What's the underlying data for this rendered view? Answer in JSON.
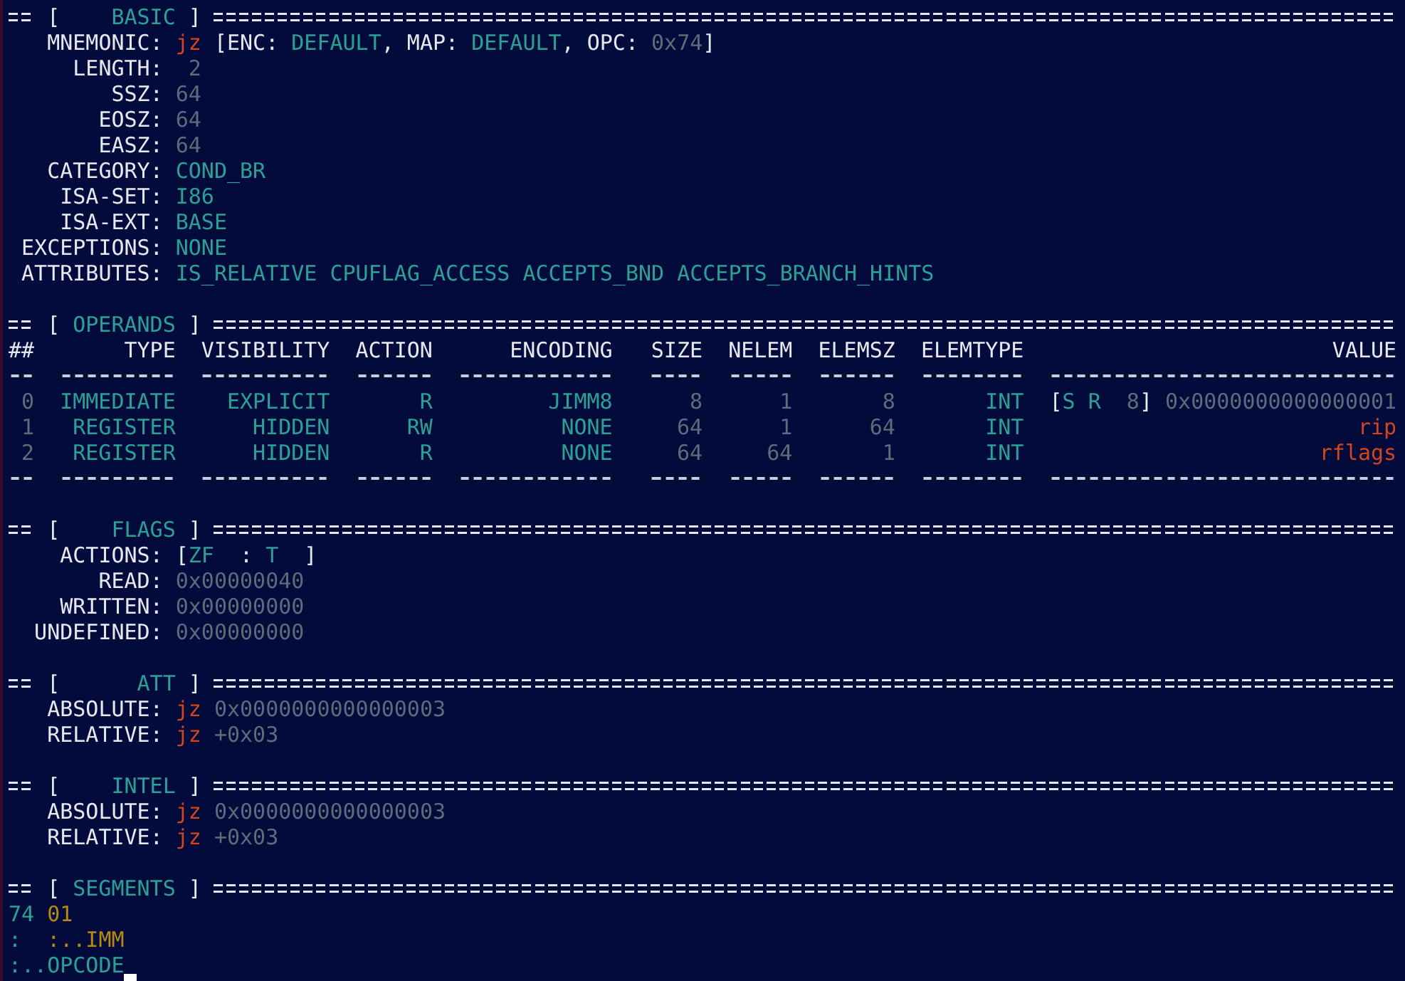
{
  "sections": [
    {
      "kind": "fields",
      "header": [
        {
          "text": "[",
          "kind": "plain"
        },
        {
          "text": "    BASIC",
          "kind": "keyword"
        },
        {
          "text": " ]",
          "kind": "plain"
        }
      ],
      "fields": [
        {
          "label": "MNEMONIC:",
          "value": [
            {
              "text": "jz",
              "kind": "mnemonic"
            },
            {
              "text": " [ENC: ",
              "kind": "plain"
            },
            {
              "text": "DEFAULT",
              "kind": "keyword"
            },
            {
              "text": ", MAP: ",
              "kind": "plain"
            },
            {
              "text": "DEFAULT",
              "kind": "keyword"
            },
            {
              "text": ", OPC: ",
              "kind": "plain"
            },
            {
              "text": "0x74",
              "kind": "number"
            },
            {
              "text": "]",
              "kind": "plain"
            }
          ]
        },
        {
          "label": "LENGTH:",
          "value": [
            {
              "text": " 2",
              "kind": "number"
            }
          ]
        },
        {
          "label": "SSZ:",
          "value": [
            {
              "text": "64",
              "kind": "number"
            }
          ]
        },
        {
          "label": "EOSZ:",
          "value": [
            {
              "text": "64",
              "kind": "number"
            }
          ]
        },
        {
          "label": "EASZ:",
          "value": [
            {
              "text": "64",
              "kind": "number"
            }
          ]
        },
        {
          "label": "CATEGORY:",
          "value": [
            {
              "text": "COND_BR",
              "kind": "keyword"
            }
          ]
        },
        {
          "label": "ISA-SET:",
          "value": [
            {
              "text": "I86",
              "kind": "keyword"
            }
          ]
        },
        {
          "label": "ISA-EXT:",
          "value": [
            {
              "text": "BASE",
              "kind": "keyword"
            }
          ]
        },
        {
          "label": "EXCEPTIONS:",
          "value": [
            {
              "text": "NONE",
              "kind": "keyword"
            }
          ]
        },
        {
          "label": "ATTRIBUTES:",
          "value": [
            {
              "text": "IS_RELATIVE CPUFLAG_ACCESS ACCEPTS_BND ACCEPTS_BRANCH_HINTS",
              "kind": "keyword"
            }
          ]
        }
      ]
    },
    {
      "kind": "table",
      "header": [
        {
          "text": "[",
          "kind": "plain"
        },
        {
          "text": " OPERANDS",
          "kind": "keyword"
        },
        {
          "text": " ]",
          "kind": "plain"
        }
      ],
      "columns": [
        "##",
        "TYPE",
        "VISIBILITY",
        "ACTION",
        "ENCODING",
        "SIZE",
        "NELEM",
        "ELEMSZ",
        "ELEMTYPE",
        "VALUE"
      ],
      "rows": [
        {
          "cells": [
            "0",
            "IMMEDIATE",
            "EXPLICIT",
            "R",
            "JIMM8",
            "8",
            "1",
            "8",
            "INT"
          ],
          "value": [
            {
              "text": "[",
              "kind": "plain"
            },
            {
              "text": "S R",
              "kind": "keyword"
            },
            {
              "text": "  8",
              "kind": "number"
            },
            {
              "text": "]",
              "kind": "plain"
            },
            {
              "text": " 0x0000000000000001",
              "kind": "number"
            }
          ]
        },
        {
          "cells": [
            "1",
            "REGISTER",
            "HIDDEN",
            "RW",
            "NONE",
            "64",
            "1",
            "64",
            "INT"
          ],
          "value": [
            {
              "text": "rip",
              "kind": "mnemonic"
            }
          ]
        },
        {
          "cells": [
            "2",
            "REGISTER",
            "HIDDEN",
            "R",
            "NONE",
            "64",
            "64",
            "1",
            "INT"
          ],
          "value": [
            {
              "text": "rflags",
              "kind": "mnemonic"
            }
          ]
        }
      ]
    },
    {
      "kind": "fields",
      "header": [
        {
          "text": "[",
          "kind": "plain"
        },
        {
          "text": "    FLAGS",
          "kind": "keyword"
        },
        {
          "text": " ]",
          "kind": "plain"
        }
      ],
      "fields": [
        {
          "label": "ACTIONS:",
          "value": [
            {
              "text": "[",
              "kind": "plain"
            },
            {
              "text": "ZF",
              "kind": "keyword"
            },
            {
              "text": "  : ",
              "kind": "plain"
            },
            {
              "text": "T",
              "kind": "keyword"
            },
            {
              "text": "  ]",
              "kind": "plain"
            }
          ]
        },
        {
          "label": "READ:",
          "value": [
            {
              "text": "0x00000040",
              "kind": "number"
            }
          ]
        },
        {
          "label": "WRITTEN:",
          "value": [
            {
              "text": "0x00000000",
              "kind": "number"
            }
          ]
        },
        {
          "label": "UNDEFINED:",
          "value": [
            {
              "text": "0x00000000",
              "kind": "number"
            }
          ]
        }
      ]
    },
    {
      "kind": "fields",
      "header": [
        {
          "text": "[",
          "kind": "plain"
        },
        {
          "text": "      ATT",
          "kind": "keyword"
        },
        {
          "text": " ]",
          "kind": "plain"
        }
      ],
      "fields": [
        {
          "label": "ABSOLUTE:",
          "value": [
            {
              "text": "jz",
              "kind": "mnemonic"
            },
            {
              "text": " 0x0000000000000003",
              "kind": "number"
            }
          ]
        },
        {
          "label": "RELATIVE:",
          "value": [
            {
              "text": "jz",
              "kind": "mnemonic"
            },
            {
              "text": " +0x03",
              "kind": "number"
            }
          ]
        }
      ]
    },
    {
      "kind": "fields",
      "header": [
        {
          "text": "[",
          "kind": "plain"
        },
        {
          "text": "    INTEL",
          "kind": "keyword"
        },
        {
          "text": " ]",
          "kind": "plain"
        }
      ],
      "fields": [
        {
          "label": "ABSOLUTE:",
          "value": [
            {
              "text": "jz",
              "kind": "mnemonic"
            },
            {
              "text": " 0x0000000000000003",
              "kind": "number"
            }
          ]
        },
        {
          "label": "RELATIVE:",
          "value": [
            {
              "text": "jz",
              "kind": "mnemonic"
            },
            {
              "text": " +0x03",
              "kind": "number"
            }
          ]
        }
      ]
    },
    {
      "kind": "listing",
      "header": [
        {
          "text": "[",
          "kind": "plain"
        },
        {
          "text": " SEGMENTS",
          "kind": "keyword"
        },
        {
          "text": " ]",
          "kind": "plain"
        }
      ],
      "lines": [
        [
          {
            "text": "74",
            "kind": "opcode"
          },
          {
            "text": " 01",
            "kind": "immediate"
          }
        ],
        [
          {
            "text": ":",
            "kind": "opcode"
          },
          {
            "text": "  :..IMM",
            "kind": "immediate"
          }
        ],
        [
          {
            "text": ":..OPCODE",
            "kind": "opcode"
          }
        ]
      ]
    }
  ]
}
